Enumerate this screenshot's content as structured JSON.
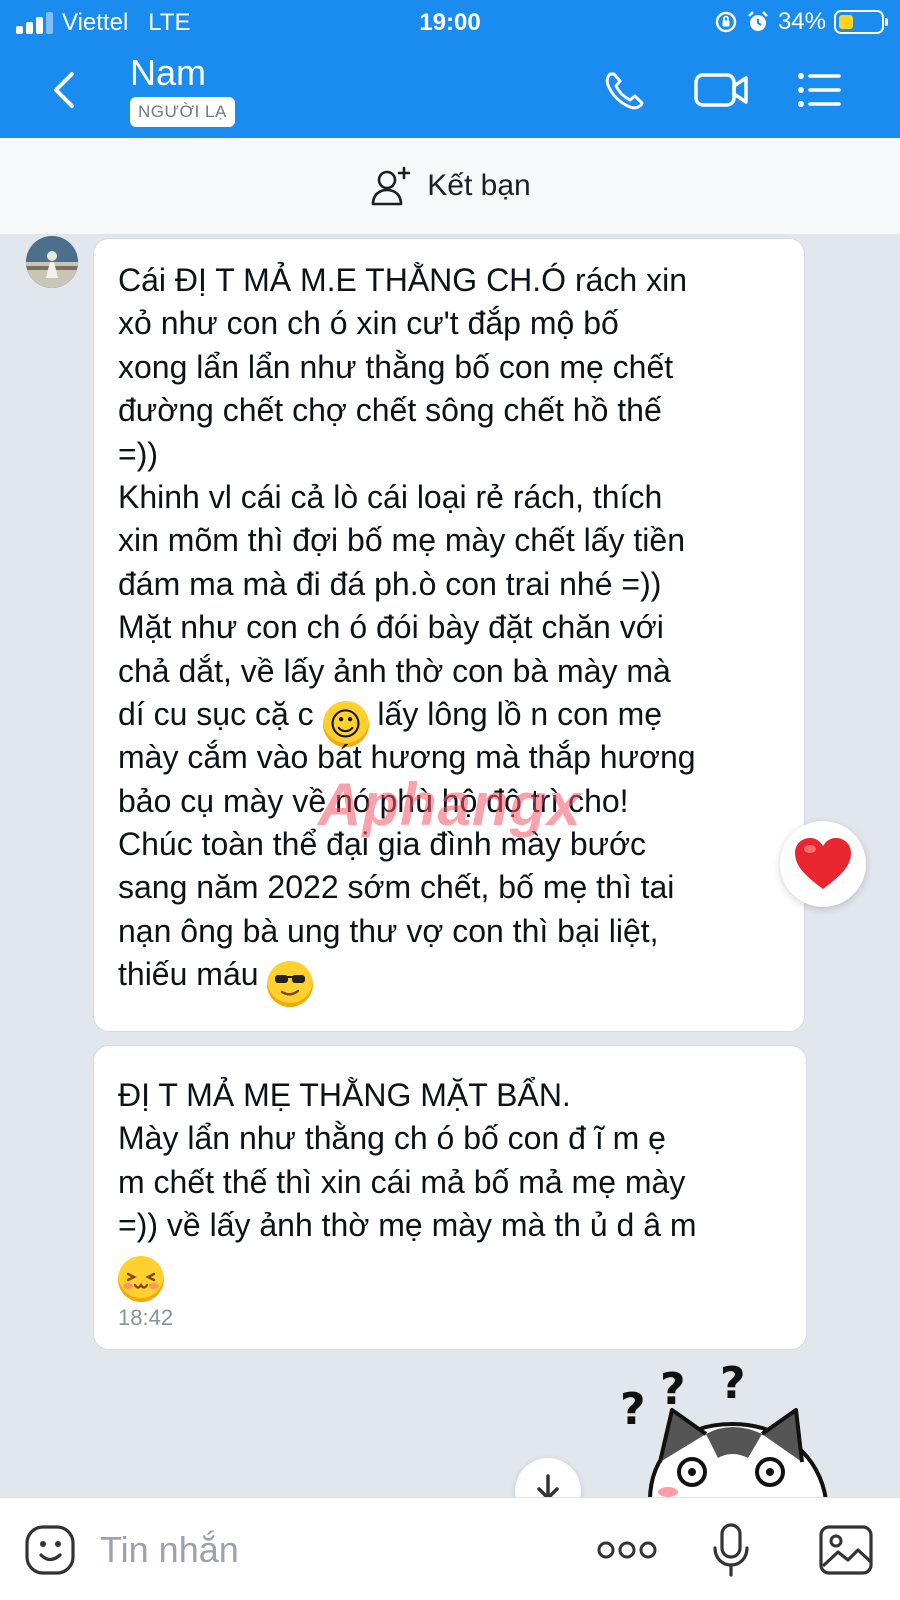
{
  "status_bar": {
    "carrier": "Viettel",
    "network": "LTE",
    "time": "19:00",
    "battery_percent": "34%",
    "battery_level": 0.34,
    "icons": [
      "signal-icon",
      "rotation-lock-icon",
      "alarm-icon",
      "battery-icon"
    ]
  },
  "header": {
    "contact_name": "Nam",
    "contact_tag": "NGƯỜI LẠ",
    "icons": [
      "back-icon",
      "phone-icon",
      "video-call-icon",
      "menu-icon"
    ],
    "colors": {
      "background": "#1a8cf0",
      "text": "#ffffff"
    }
  },
  "add_friend": {
    "label": "Kết bạn",
    "icon": "add-friend-icon"
  },
  "messages": [
    {
      "lines": [
        " Cái ĐỊ T MẢ M.E THẰNG CH.Ó rách xin",
        "xỏ như con ch ó xin cư't đắp mộ bố",
        "xong lẩn lẩn như thằng bố con mẹ chết",
        "đường chết chợ chết sông chết hồ thế",
        "=))",
        "Khinh vl cái cả lò cái loại rẻ rách, thích",
        "xin mõm thì đợi bố mẹ mày chết lấy tiền",
        "đám ma mà đi đá ph.ò con trai nhé =))",
        "Mặt như con ch ó đói bày đặt chăn với",
        "chả dắt, về lấy ảnh thờ con bà mày mà"
      ],
      "line_with_emoji": {
        "before": "dí cu sục cặ c ",
        "emoji": "grinning-face-emoji",
        "after": " lấy lông lồ n con mẹ"
      },
      "lines_after": [
        "mày cắm vào bát hương mà thắp hương",
        "bảo cụ mày về nó phù hộ độ trì cho!",
        "Chúc toàn thể đại gia đình mày bước",
        "sang năm 2022 sớm chết, bố mẹ thì tai",
        "nạn ông bà ung thư vợ con thì bại liệt,"
      ],
      "last_line": {
        "before": "thiếu máu ",
        "emoji": "sunglasses-face-emoji"
      },
      "reaction": "heart-icon"
    },
    {
      "lines": [
        "ĐỊ T MẢ MẸ THẰNG MẶT BẨN.",
        "Mày lẩn như thằng ch ó bố con đ ĩ m ẹ",
        "m chết thế thì xin cái mả bố mả mẹ mày",
        "=)) về lấy ảnh thờ mẹ mày mà th ủ d â m"
      ],
      "emoji": "blushing-smile-emoji",
      "timestamp": "18:42"
    }
  ],
  "watermark": "Aphangx",
  "sticker": "confused-husky-sticker",
  "composer": {
    "placeholder": "Tin nhắn",
    "icons": [
      "emoji-icon",
      "more-icon",
      "microphone-icon",
      "image-icon"
    ]
  }
}
